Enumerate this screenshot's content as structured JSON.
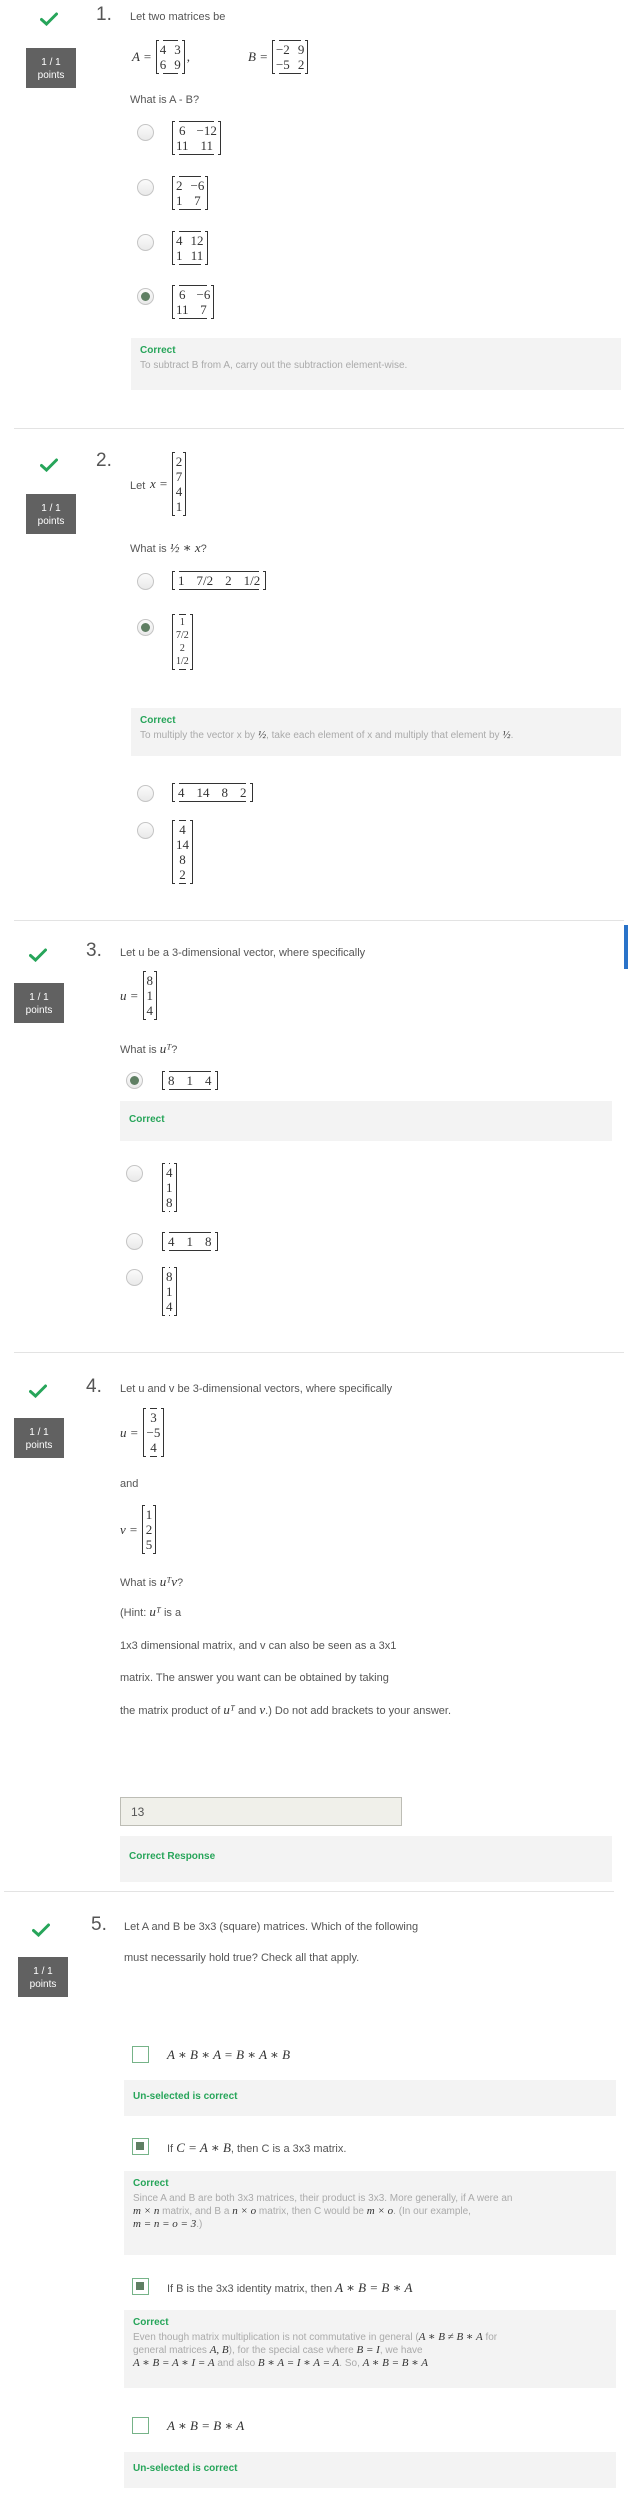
{
  "points_label": [
    "1 / 1",
    "points"
  ],
  "q1": {
    "number": "1.",
    "intro": "Let two matrices be",
    "A": {
      "label": "A =",
      "rows": [
        [
          "4",
          "3"
        ],
        [
          "6",
          "9"
        ]
      ]
    },
    "B": {
      "label": "B =",
      "rows": [
        [
          "−2",
          "9"
        ],
        [
          "−5",
          "2"
        ]
      ]
    },
    "question": "What is A - B?",
    "options": [
      {
        "rows": [
          [
            "6",
            "−12"
          ],
          [
            "11",
            "11"
          ]
        ],
        "selected": false
      },
      {
        "rows": [
          [
            "2",
            "−6"
          ],
          [
            "1",
            "7"
          ]
        ],
        "selected": false
      },
      {
        "rows": [
          [
            "4",
            "12"
          ],
          [
            "1",
            "11"
          ]
        ],
        "selected": false
      },
      {
        "rows": [
          [
            "6",
            "−6"
          ],
          [
            "11",
            "7"
          ]
        ],
        "selected": true
      }
    ],
    "feedback_title": "Correct",
    "feedback_text": "To subtract B from A, carry out the subtraction element-wise."
  },
  "q2": {
    "number": "2.",
    "intro_prefix": "Let",
    "x_label": "x =",
    "x_values": [
      "2",
      "7",
      "4",
      "1"
    ],
    "question_prefix": "What is",
    "question_math": "½ ∗ x",
    "question_suffix": "?",
    "options": [
      {
        "type": "row",
        "values": [
          "1",
          "7/2",
          "2",
          "1/2"
        ],
        "selected": false
      },
      {
        "type": "col",
        "values": [
          "1",
          "7/2",
          "2",
          "1/2"
        ],
        "selected": true
      },
      {
        "type": "row",
        "values": [
          "4",
          "14",
          "8",
          "2"
        ],
        "selected": false
      },
      {
        "type": "col",
        "values": [
          "4",
          "14",
          "8",
          "2"
        ],
        "selected": false
      }
    ],
    "feedback_title": "Correct",
    "feedback_text_a": "To multiply the vector x by",
    "feedback_math": "½",
    "feedback_text_b": ", take each element of x and multiply that element by",
    "feedback_text_c": "."
  },
  "q3": {
    "number": "3.",
    "intro": "Let u be a 3-dimensional vector, where specifically",
    "u_label": "u =",
    "u_values": [
      "8",
      "1",
      "4"
    ],
    "question_prefix": "What is",
    "question_math": "uᵀ",
    "question_suffix": "?",
    "options": [
      {
        "type": "row",
        "values": [
          "8",
          "1",
          "4"
        ],
        "selected": true
      },
      {
        "type": "col",
        "values": [
          "4",
          "1",
          "8"
        ],
        "selected": false
      },
      {
        "type": "row",
        "values": [
          "4",
          "1",
          "8"
        ],
        "selected": false
      },
      {
        "type": "col",
        "values": [
          "8",
          "1",
          "4"
        ],
        "selected": false
      }
    ],
    "feedback_title": "Correct"
  },
  "q4": {
    "number": "4.",
    "intro": "Let u and v be 3-dimensional vectors, where specifically",
    "u_label": "u =",
    "u_values": [
      "3",
      "−5",
      "4"
    ],
    "and_text": "and",
    "v_label": "v =",
    "v_values": [
      "1",
      "2",
      "5"
    ],
    "question_prefix": "What is",
    "question_math": "uᵀv",
    "question_suffix": "?",
    "hint_prefix": "(Hint:",
    "hint_math": "uᵀ",
    "hint_suffix": "is a",
    "hint_line2": "1x3 dimensional matrix, and v can also be seen as a 3x1",
    "hint_line3": "matrix. The answer you want can be obtained by taking",
    "hint_line4_prefix": "the matrix product of",
    "hint_line4_math1": "uᵀ",
    "hint_line4_mid": "and",
    "hint_line4_math2": "v",
    "hint_line4_suffix": ".) Do not add brackets to your answer.",
    "answer_value": "13",
    "feedback_title": "Correct Response"
  },
  "q5": {
    "number": "5.",
    "intro_line1": "Let A and B be 3x3 (square) matrices. Which of the following",
    "intro_line2": "must necessarily hold true? Check all that apply.",
    "options": [
      {
        "label_math": "A ∗ B ∗ A = B ∗ A ∗ B",
        "selected": false,
        "feedback_title": "Un-selected is correct"
      },
      {
        "label_a": "If",
        "label_math": "C = A ∗ B",
        "label_b": ", then C is a 3x3 matrix.",
        "selected": true,
        "feedback_title": "Correct",
        "feedback_line1": "Since A and B are both 3x3 matrices, their product is 3x3. More generally, if A were an",
        "feedback_line2_math1": "m × n",
        "feedback_line2_a": "matrix, and B a",
        "feedback_line2_math2": "n × o",
        "feedback_line2_b": "matrix, then C would be",
        "feedback_line2_math3": "m × o",
        "feedback_line2_c": ". (In our example,",
        "feedback_line3_math": "m = n = o = 3",
        "feedback_line3_b": ".)"
      },
      {
        "label_a": "If B is the 3x3 identity matrix, then",
        "label_math": "A ∗ B = B ∗ A",
        "selected": true,
        "feedback_title": "Correct",
        "feedback_line1_a": "Even though matrix multiplication is not commutative in general (",
        "feedback_line1_math": "A ∗ B ≠ B ∗ A",
        "feedback_line1_b": "for",
        "feedback_line2_a": "general matrices",
        "feedback_line2_math": "A, B",
        "feedback_line2_b": "), for the special case where",
        "feedback_line2_math2": "B = I",
        "feedback_line2_c": ", we have",
        "feedback_line3_math1": "A ∗ B = A ∗ I = A",
        "feedback_line3_a": "and also",
        "feedback_line3_math2": "B ∗ A = I ∗ A = A",
        "feedback_line3_b": ". So,",
        "feedback_line3_math3": "A ∗ B = B ∗ A"
      },
      {
        "label_math": "A ∗ B = B ∗ A",
        "selected": false,
        "feedback_title": "Un-selected is correct"
      }
    ]
  },
  "colors": {
    "accent_green": "#27a55a",
    "points_bg": "#616161",
    "selected_fill": "#5f7f63",
    "right_bar": "#2a73c9"
  }
}
